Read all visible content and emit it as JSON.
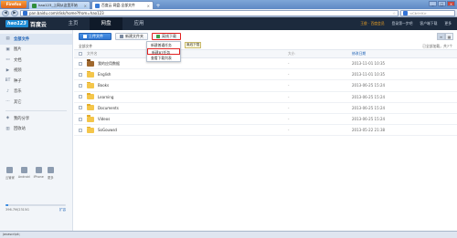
{
  "browser": {
    "menu_label": "Firefox",
    "tabs": [
      {
        "label": "hao123_上网从这里开始",
        "favicon_color": "#2f8d3a",
        "active": false
      },
      {
        "label": "百度云 网盘-全部文件",
        "favicon_color": "#3a7bd5",
        "active": true
      }
    ],
    "new_tab": "+",
    "window_buttons": [
      "_",
      "□",
      "×"
    ],
    "back": "◀",
    "forward": "▶",
    "url": "pan.baidu.com/disk/home?from=hao123",
    "search_placeholder": "<Ctrl+K>"
  },
  "header": {
    "logo_hao": "hao123",
    "logo_yun": "百度云",
    "nav": [
      {
        "label": "主页",
        "active": false
      },
      {
        "label": "网盘",
        "active": true
      },
      {
        "label": "应用",
        "active": false
      }
    ],
    "user": "王俊 · 百度会员",
    "links": [
      "登录第一步吧",
      "客户端下载",
      "更多"
    ]
  },
  "sidebar": {
    "items": [
      {
        "label": "全部文件",
        "icon": "▤",
        "active": true
      },
      {
        "label": "图片",
        "icon": "▣",
        "active": false
      },
      {
        "label": "文档",
        "icon": "▭",
        "active": false
      },
      {
        "label": "视频",
        "icon": "▶",
        "active": false
      },
      {
        "label": "种子",
        "icon": "BT",
        "active": false
      },
      {
        "label": "音乐",
        "icon": "♪",
        "active": false
      },
      {
        "label": "其它",
        "icon": "⋯",
        "active": false
      }
    ],
    "items2": [
      {
        "label": "我的分享",
        "icon": "◈"
      },
      {
        "label": "回收站",
        "icon": "▥"
      }
    ],
    "devices": [
      "云管家",
      "Android",
      "iPhone",
      "更多"
    ],
    "quota": {
      "used_text": "396.7M/2315G",
      "expand": "扩容",
      "used_fraction": 0.04
    }
  },
  "toolbar": {
    "upload": "上传文件",
    "new_folder": "新建文件夹",
    "offline_download": "离线下载",
    "view_list": "≡",
    "view_grid": "▦"
  },
  "offline_menu": {
    "items": [
      "新建普通任务",
      "新建BT任务",
      "查看下载列表"
    ],
    "highlighted_index": 1
  },
  "tooltip": "离线下载",
  "path": {
    "label": "全部文件",
    "loaded": "已全部加载，共7个"
  },
  "table": {
    "headers": {
      "name": "文件名",
      "size": "大小",
      "date": "修改日期"
    },
    "rows": [
      {
        "name": "我的应用数据",
        "size": "-",
        "date": "2013-11-01 10:35",
        "type": "app"
      },
      {
        "name": "English",
        "size": "-",
        "date": "2013-11-01 10:35",
        "type": "folder"
      },
      {
        "name": "Books",
        "size": "-",
        "date": "2013-06-25 15:24",
        "type": "folder"
      },
      {
        "name": "Learning",
        "size": "-",
        "date": "2013-06-25 15:24",
        "type": "folder"
      },
      {
        "name": "Documents",
        "size": "-",
        "date": "2013-06-25 15:24",
        "type": "folder"
      },
      {
        "name": "Videos",
        "size": "-",
        "date": "2013-06-25 15:24",
        "type": "folder"
      },
      {
        "name": "SoGouwsd",
        "size": "-",
        "date": "2013-05-22 21:38",
        "type": "folder"
      }
    ]
  },
  "status_text": "javascript:;"
}
